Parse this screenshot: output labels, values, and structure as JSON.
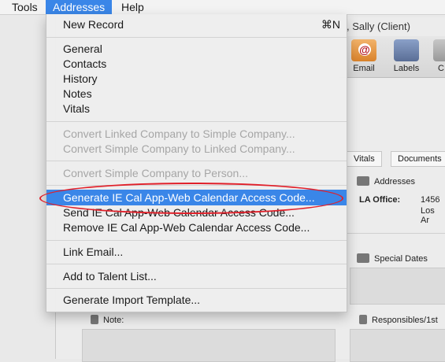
{
  "menubar": {
    "items": [
      "Tools",
      "Addresses",
      "Help"
    ]
  },
  "window": {
    "title": ", Sally (Client)",
    "toolbar": [
      "Email",
      "Labels",
      "C"
    ],
    "tabs": [
      "Vitals",
      "Documents"
    ],
    "addresses_heading": "Addresses",
    "address_label": "LA Office:",
    "address_line1": "1456 ",
    "address_line2": "Los Ar",
    "special_dates_heading": "Special Dates",
    "note_heading": "Note:",
    "responsibles_heading": "Responsibles/1st"
  },
  "menu": {
    "new_record": "New Record",
    "new_record_shortcut": "⌘N",
    "general": "General",
    "contacts": "Contacts",
    "history": "History",
    "notes": "Notes",
    "vitals": "Vitals",
    "convert_linked_to_simple": "Convert Linked Company to Simple Company...",
    "convert_simple_to_linked": "Convert Simple Company to Linked Company...",
    "convert_simple_to_person": "Convert Simple Company to Person...",
    "generate_code": "Generate IE Cal App-Web Calendar Access Code...",
    "send_code": "Send IE Cal App-Web Calendar Access Code...",
    "remove_code": "Remove IE Cal App-Web Calendar Access Code...",
    "link_email": "Link Email...",
    "add_to_talent": "Add to Talent List...",
    "generate_import": "Generate Import Template..."
  },
  "colors": {
    "accent": "#3a86e8",
    "annotation": "#e0202a"
  }
}
